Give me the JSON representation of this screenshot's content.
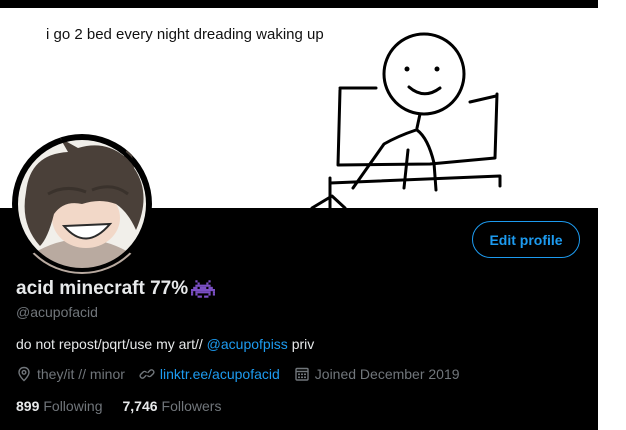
{
  "banner": {
    "caption": "i go 2 bed every night dreading waking up"
  },
  "profile": {
    "display_name": "acid minecraft 77%",
    "name_emoji": "space-invader-icon",
    "handle": "@acupofacid",
    "edit_button_label": "Edit profile",
    "bio": {
      "text_before": "do not repost/pqrt/use my art// ",
      "mention": "@acupofpiss",
      "text_after": " priv"
    },
    "location": "they/it // minor",
    "website": "linktr.ee/acupofacid",
    "joined": "Joined December 2019",
    "following_count": "899",
    "following_label": "Following",
    "followers_count": "7,746",
    "followers_label": "Followers"
  },
  "colors": {
    "accent": "#1d9bf0",
    "background": "#000000",
    "text_primary": "#e7e9ea",
    "text_secondary": "#71767b",
    "emoji": "#7b4fc4"
  }
}
